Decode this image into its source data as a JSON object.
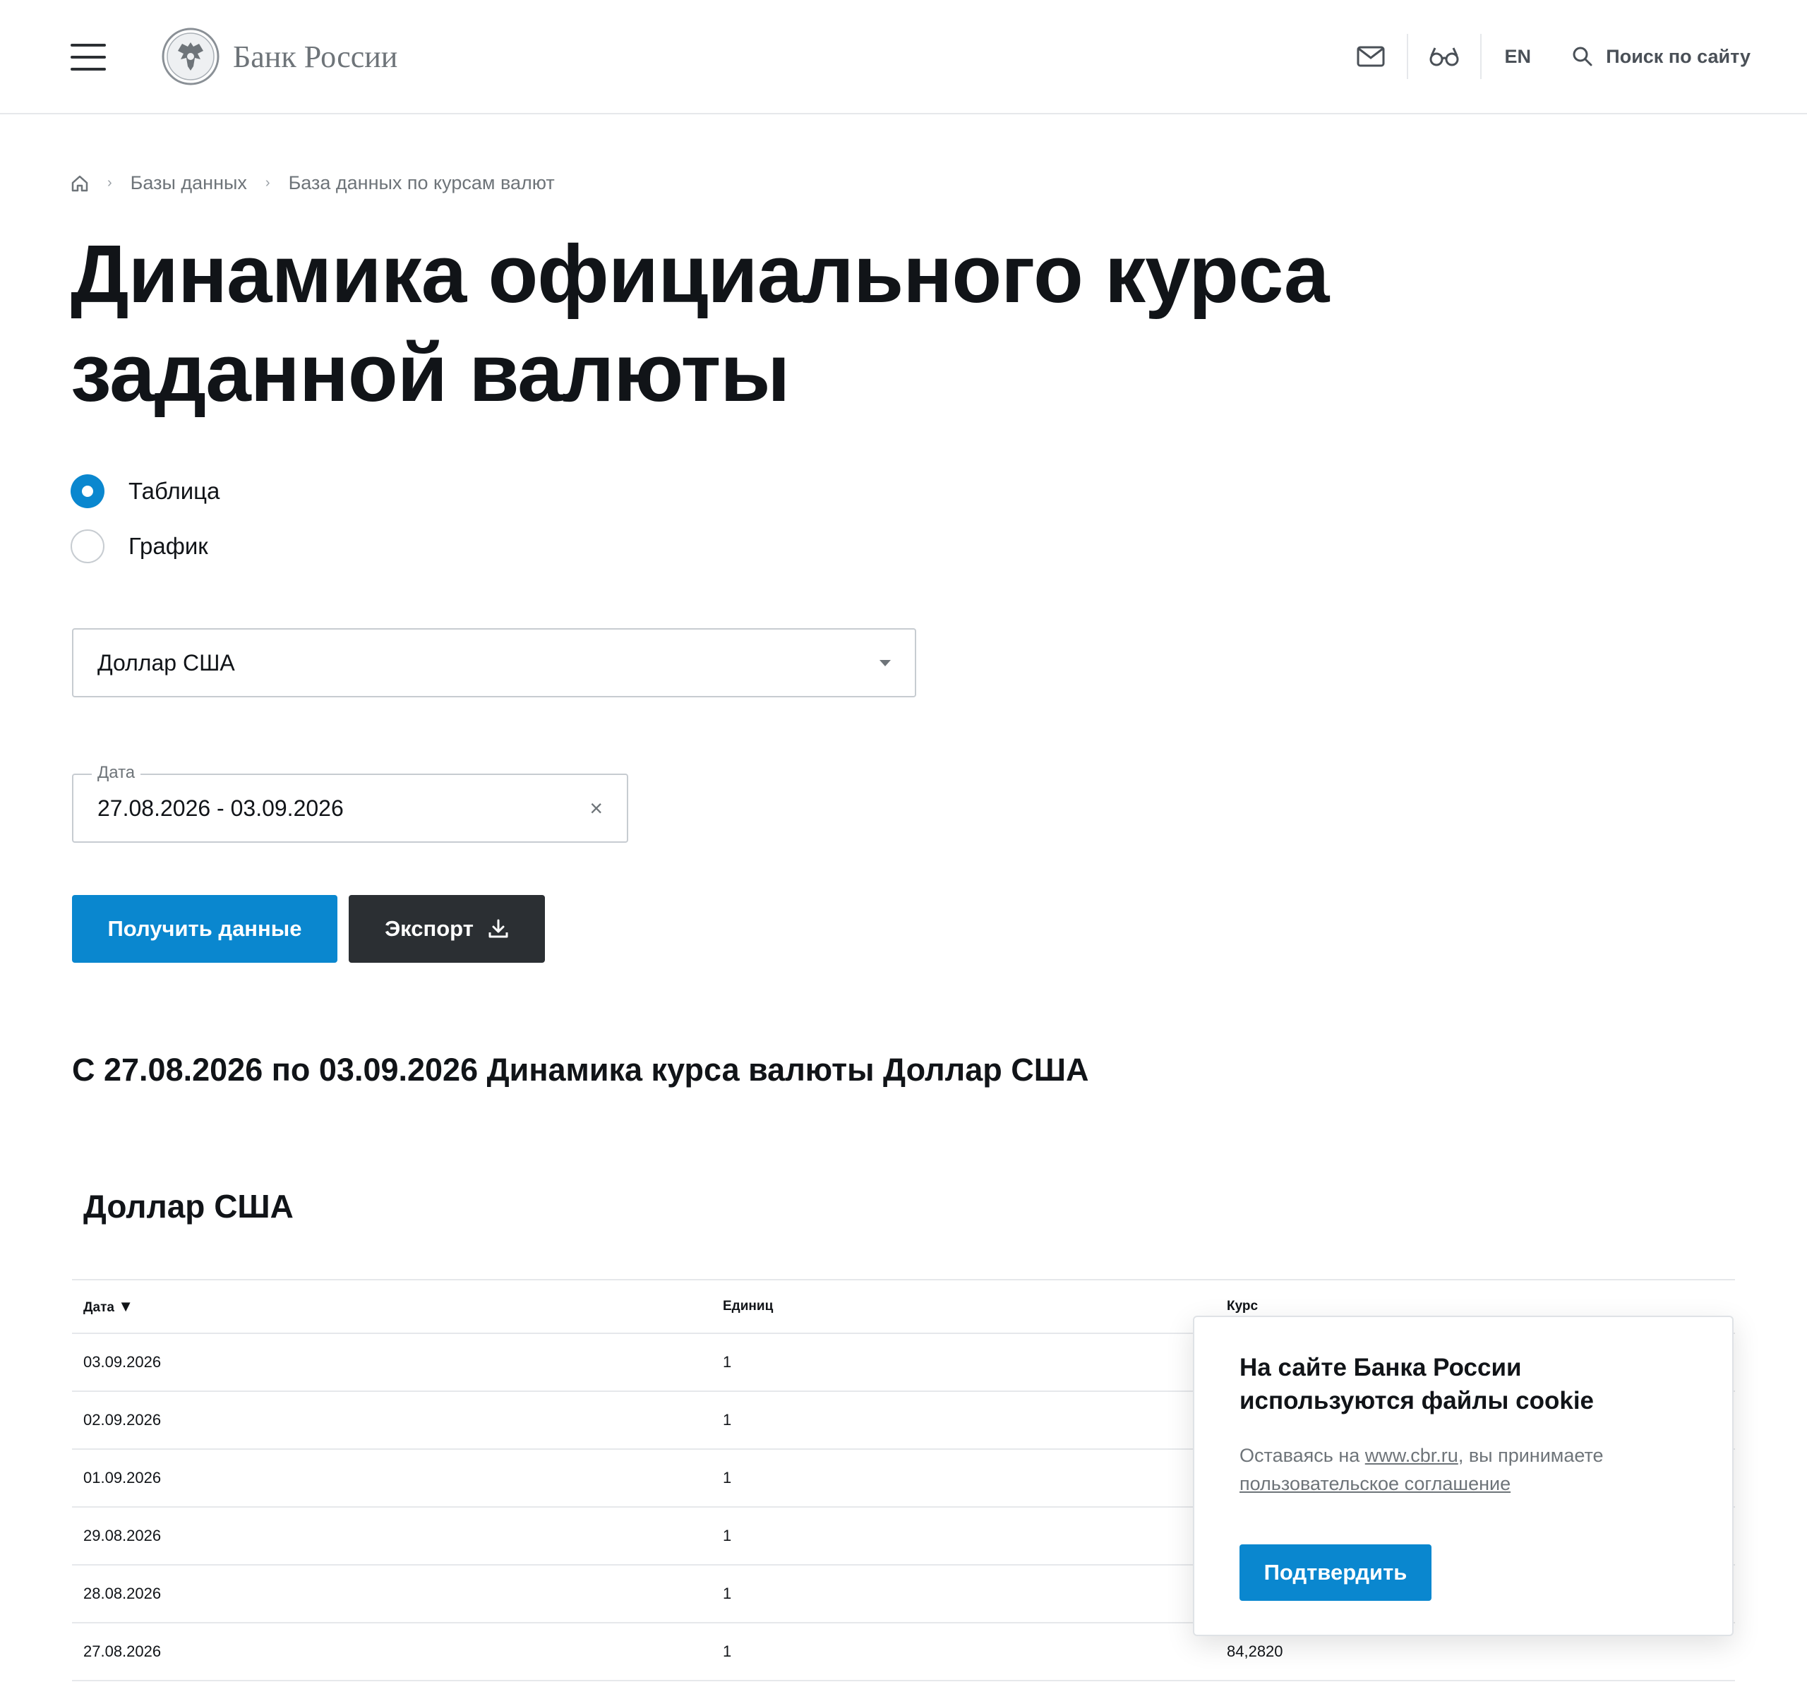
{
  "header": {
    "logo_text": "Банк России",
    "lang": "EN",
    "search_label": "Поиск по сайту"
  },
  "breadcrumb": {
    "items": [
      "Базы данных",
      "База данных по курсам валют"
    ]
  },
  "page_title_line1": "Динамика официального курса",
  "page_title_line2": "заданной валюты",
  "view_options": [
    {
      "label": "Таблица",
      "selected": true
    },
    {
      "label": "График",
      "selected": false
    }
  ],
  "currency_select": {
    "value": "Доллар США"
  },
  "date_field": {
    "legend": "Дата",
    "value": "27.08.2026 - 03.09.2026",
    "clear": "×"
  },
  "buttons": {
    "get_data": "Получить данные",
    "export": "Экспорт"
  },
  "result_heading": "С 27.08.2026 по 03.09.2026 Динамика курса валюты Доллар США",
  "table": {
    "title": "Доллар США",
    "columns": [
      "Дата",
      "Единиц",
      "Курс"
    ],
    "sort_marker": "▼",
    "rows": [
      {
        "date": "03.09.2026",
        "units": "1",
        "rate": ""
      },
      {
        "date": "02.09.2026",
        "units": "1",
        "rate": ""
      },
      {
        "date": "01.09.2026",
        "units": "1",
        "rate": ""
      },
      {
        "date": "29.08.2026",
        "units": "1",
        "rate": ""
      },
      {
        "date": "28.08.2026",
        "units": "1",
        "rate": ""
      },
      {
        "date": "27.08.2026",
        "units": "1",
        "rate": "84,2820"
      }
    ]
  },
  "cookie": {
    "title": "На сайте Банка России используются файлы cookie",
    "text_prefix": "Оставаясь на ",
    "link1": "www.cbr.ru",
    "text_middle": ", вы принимаете",
    "link2": "пользовательское соглашение",
    "button": "Подтвердить"
  },
  "colors": {
    "accent": "#0a87cf",
    "dark_button": "#2b2f33",
    "muted_text": "#6e7479"
  }
}
